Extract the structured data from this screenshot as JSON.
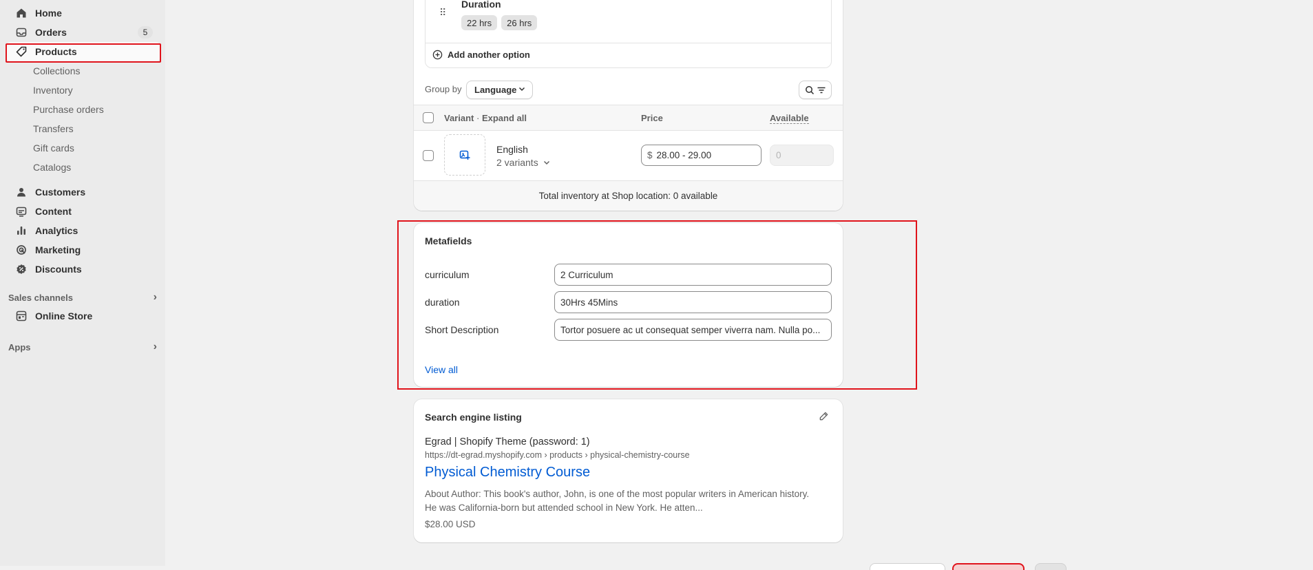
{
  "sidebar": {
    "items": [
      {
        "label": "Home",
        "icon": "home-icon"
      },
      {
        "label": "Orders",
        "icon": "inbox-icon",
        "badge": "5"
      },
      {
        "label": "Products",
        "icon": "tag-icon"
      }
    ],
    "product_subitems": [
      "Collections",
      "Inventory",
      "Purchase orders",
      "Transfers",
      "Gift cards",
      "Catalogs"
    ],
    "items2": [
      {
        "label": "Customers",
        "icon": "person-icon"
      },
      {
        "label": "Content",
        "icon": "image-icon"
      },
      {
        "label": "Analytics",
        "icon": "bar-chart-icon"
      },
      {
        "label": "Marketing",
        "icon": "target-icon"
      },
      {
        "label": "Discounts",
        "icon": "discount-icon"
      }
    ],
    "sales_channels_label": "Sales channels",
    "online_store_label": "Online Store",
    "apps_label": "Apps"
  },
  "variants": {
    "option_name": "Duration",
    "option_values": [
      "22 hrs",
      "26 hrs"
    ],
    "add_option_label": "Add another option",
    "group_by_label": "Group by",
    "group_by_value": "Language",
    "columns": {
      "variant": "Variant",
      "expand_all": "Expand all",
      "separator": "·",
      "price": "Price",
      "available": "Available"
    },
    "row": {
      "name": "English",
      "sub": "2 variants",
      "currency": "$",
      "price": "28.00 - 29.00",
      "available_placeholder": "0"
    },
    "total_inventory": "Total inventory at Shop location: 0 available"
  },
  "metafields": {
    "title": "Metafields",
    "fields": [
      {
        "label": "curriculum",
        "value": "2 Curriculum"
      },
      {
        "label": "duration",
        "value": "30Hrs 45Mins"
      },
      {
        "label": "Short Description",
        "value": "Tortor posuere ac ut consequat semper viverra nam. Nulla po..."
      }
    ],
    "view_all": "View all"
  },
  "seo": {
    "title": "Search engine listing",
    "store_title": "Egrad | Shopify Theme (password: 1)",
    "url": "https://dt-egrad.myshopify.com › products › physical-chemistry-course",
    "page_title": "Physical Chemistry Course",
    "description_line1": "About Author: This book's author, John, is one of the most popular writers in American history.",
    "description_line2": "He was California-born but attended school in New York. He atten...",
    "price": "$28.00 USD"
  },
  "colors": {
    "highlight": "#e0131b",
    "link": "#005bd3",
    "sidebar_bg": "#ebebeb",
    "page_bg": "#f1f1f1"
  }
}
